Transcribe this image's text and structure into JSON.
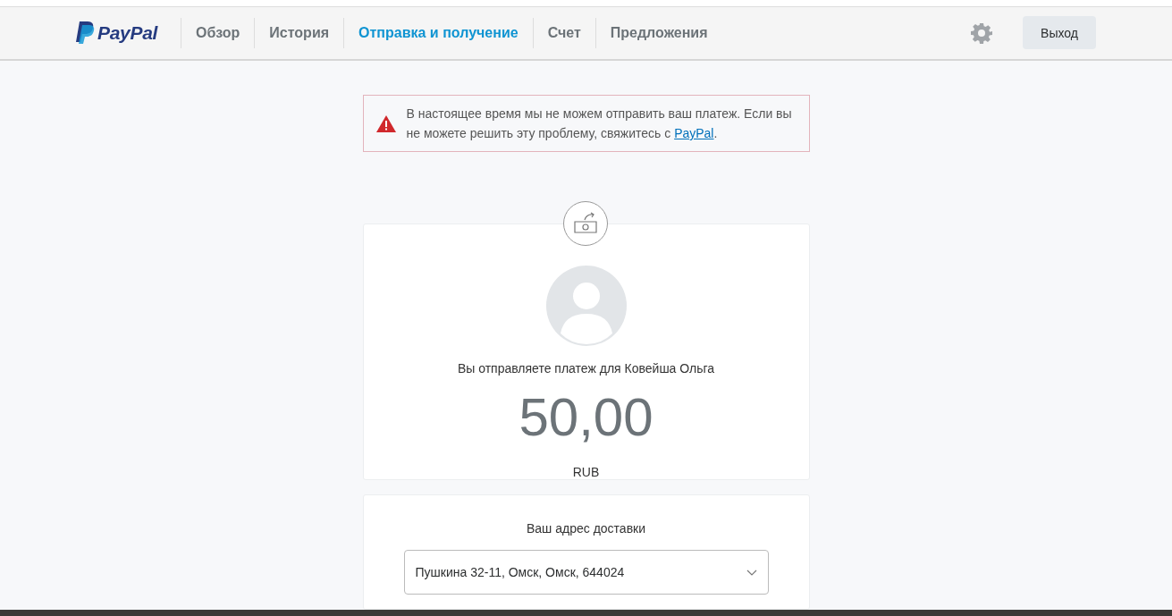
{
  "header": {
    "logo": "PayPal",
    "nav": [
      {
        "label": "Обзор",
        "selected": false
      },
      {
        "label": "История",
        "selected": false
      },
      {
        "label": "Отправка и получение",
        "selected": true
      },
      {
        "label": "Счет",
        "selected": false
      },
      {
        "label": "Предложения",
        "selected": false
      }
    ],
    "logout": "Выход"
  },
  "alert": {
    "text": "В настоящее время мы не можем отправить ваш платеж. Если вы не можете решить эту проблему, свяжитесь с ",
    "link": "PayPal",
    "text_end": "."
  },
  "payment": {
    "recipient_text": "Вы отправляете платеж для Ковейша Ольга",
    "amount": "50,00",
    "currency": "RUB"
  },
  "shipping": {
    "label": "Ваш адрес доставки",
    "address": "Пушкина 32-11, Омск, Омск, 644024"
  }
}
